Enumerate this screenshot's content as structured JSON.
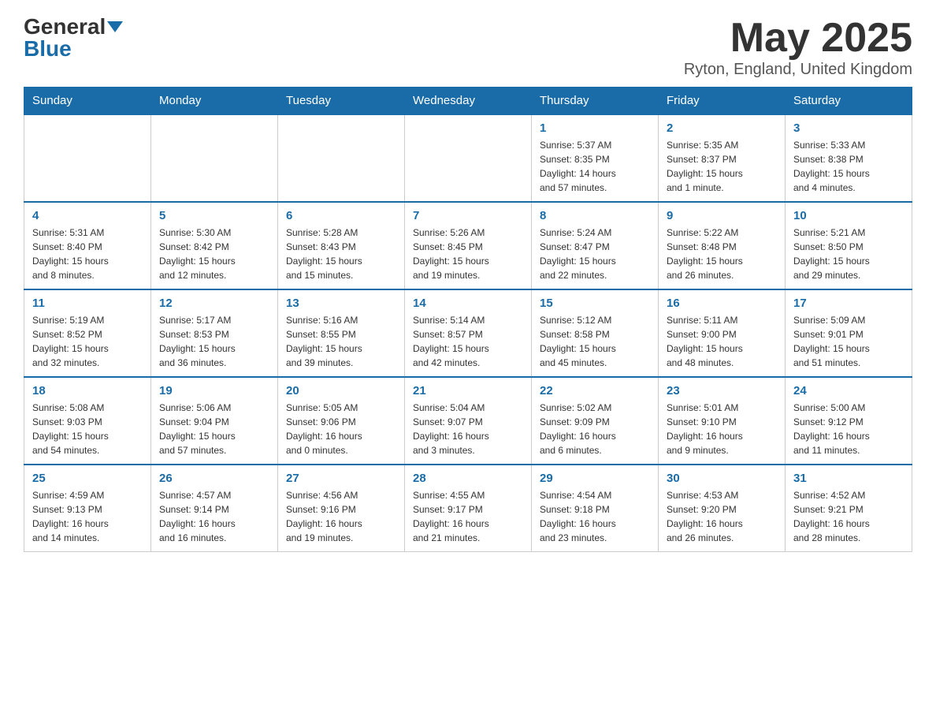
{
  "header": {
    "logo_general": "General",
    "logo_blue": "Blue",
    "month_title": "May 2025",
    "location": "Ryton, England, United Kingdom"
  },
  "days_of_week": [
    "Sunday",
    "Monday",
    "Tuesday",
    "Wednesday",
    "Thursday",
    "Friday",
    "Saturday"
  ],
  "weeks": [
    {
      "days": [
        {
          "num": "",
          "info": ""
        },
        {
          "num": "",
          "info": ""
        },
        {
          "num": "",
          "info": ""
        },
        {
          "num": "",
          "info": ""
        },
        {
          "num": "1",
          "info": "Sunrise: 5:37 AM\nSunset: 8:35 PM\nDaylight: 14 hours\nand 57 minutes."
        },
        {
          "num": "2",
          "info": "Sunrise: 5:35 AM\nSunset: 8:37 PM\nDaylight: 15 hours\nand 1 minute."
        },
        {
          "num": "3",
          "info": "Sunrise: 5:33 AM\nSunset: 8:38 PM\nDaylight: 15 hours\nand 4 minutes."
        }
      ]
    },
    {
      "days": [
        {
          "num": "4",
          "info": "Sunrise: 5:31 AM\nSunset: 8:40 PM\nDaylight: 15 hours\nand 8 minutes."
        },
        {
          "num": "5",
          "info": "Sunrise: 5:30 AM\nSunset: 8:42 PM\nDaylight: 15 hours\nand 12 minutes."
        },
        {
          "num": "6",
          "info": "Sunrise: 5:28 AM\nSunset: 8:43 PM\nDaylight: 15 hours\nand 15 minutes."
        },
        {
          "num": "7",
          "info": "Sunrise: 5:26 AM\nSunset: 8:45 PM\nDaylight: 15 hours\nand 19 minutes."
        },
        {
          "num": "8",
          "info": "Sunrise: 5:24 AM\nSunset: 8:47 PM\nDaylight: 15 hours\nand 22 minutes."
        },
        {
          "num": "9",
          "info": "Sunrise: 5:22 AM\nSunset: 8:48 PM\nDaylight: 15 hours\nand 26 minutes."
        },
        {
          "num": "10",
          "info": "Sunrise: 5:21 AM\nSunset: 8:50 PM\nDaylight: 15 hours\nand 29 minutes."
        }
      ]
    },
    {
      "days": [
        {
          "num": "11",
          "info": "Sunrise: 5:19 AM\nSunset: 8:52 PM\nDaylight: 15 hours\nand 32 minutes."
        },
        {
          "num": "12",
          "info": "Sunrise: 5:17 AM\nSunset: 8:53 PM\nDaylight: 15 hours\nand 36 minutes."
        },
        {
          "num": "13",
          "info": "Sunrise: 5:16 AM\nSunset: 8:55 PM\nDaylight: 15 hours\nand 39 minutes."
        },
        {
          "num": "14",
          "info": "Sunrise: 5:14 AM\nSunset: 8:57 PM\nDaylight: 15 hours\nand 42 minutes."
        },
        {
          "num": "15",
          "info": "Sunrise: 5:12 AM\nSunset: 8:58 PM\nDaylight: 15 hours\nand 45 minutes."
        },
        {
          "num": "16",
          "info": "Sunrise: 5:11 AM\nSunset: 9:00 PM\nDaylight: 15 hours\nand 48 minutes."
        },
        {
          "num": "17",
          "info": "Sunrise: 5:09 AM\nSunset: 9:01 PM\nDaylight: 15 hours\nand 51 minutes."
        }
      ]
    },
    {
      "days": [
        {
          "num": "18",
          "info": "Sunrise: 5:08 AM\nSunset: 9:03 PM\nDaylight: 15 hours\nand 54 minutes."
        },
        {
          "num": "19",
          "info": "Sunrise: 5:06 AM\nSunset: 9:04 PM\nDaylight: 15 hours\nand 57 minutes."
        },
        {
          "num": "20",
          "info": "Sunrise: 5:05 AM\nSunset: 9:06 PM\nDaylight: 16 hours\nand 0 minutes."
        },
        {
          "num": "21",
          "info": "Sunrise: 5:04 AM\nSunset: 9:07 PM\nDaylight: 16 hours\nand 3 minutes."
        },
        {
          "num": "22",
          "info": "Sunrise: 5:02 AM\nSunset: 9:09 PM\nDaylight: 16 hours\nand 6 minutes."
        },
        {
          "num": "23",
          "info": "Sunrise: 5:01 AM\nSunset: 9:10 PM\nDaylight: 16 hours\nand 9 minutes."
        },
        {
          "num": "24",
          "info": "Sunrise: 5:00 AM\nSunset: 9:12 PM\nDaylight: 16 hours\nand 11 minutes."
        }
      ]
    },
    {
      "days": [
        {
          "num": "25",
          "info": "Sunrise: 4:59 AM\nSunset: 9:13 PM\nDaylight: 16 hours\nand 14 minutes."
        },
        {
          "num": "26",
          "info": "Sunrise: 4:57 AM\nSunset: 9:14 PM\nDaylight: 16 hours\nand 16 minutes."
        },
        {
          "num": "27",
          "info": "Sunrise: 4:56 AM\nSunset: 9:16 PM\nDaylight: 16 hours\nand 19 minutes."
        },
        {
          "num": "28",
          "info": "Sunrise: 4:55 AM\nSunset: 9:17 PM\nDaylight: 16 hours\nand 21 minutes."
        },
        {
          "num": "29",
          "info": "Sunrise: 4:54 AM\nSunset: 9:18 PM\nDaylight: 16 hours\nand 23 minutes."
        },
        {
          "num": "30",
          "info": "Sunrise: 4:53 AM\nSunset: 9:20 PM\nDaylight: 16 hours\nand 26 minutes."
        },
        {
          "num": "31",
          "info": "Sunrise: 4:52 AM\nSunset: 9:21 PM\nDaylight: 16 hours\nand 28 minutes."
        }
      ]
    }
  ]
}
